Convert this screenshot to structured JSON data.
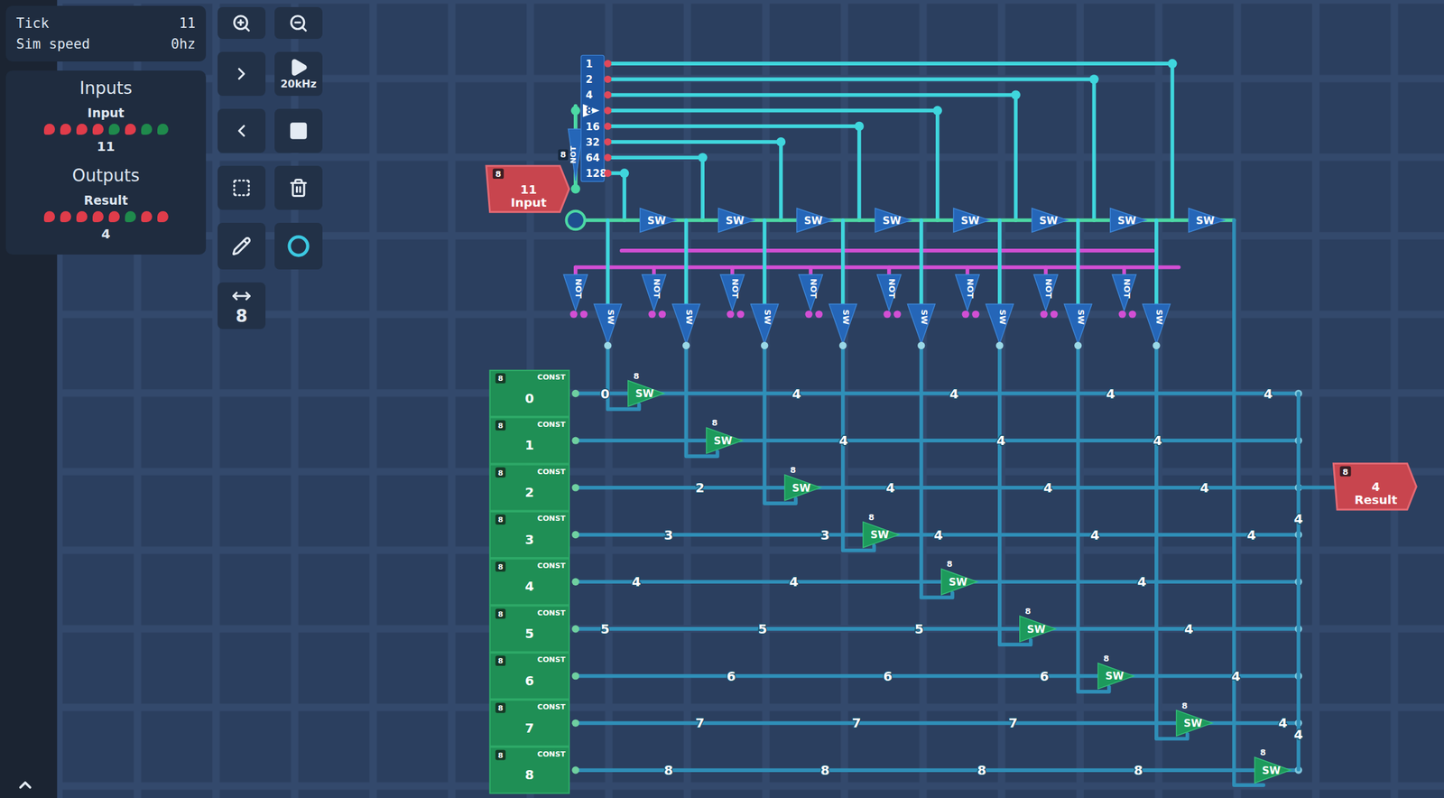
{
  "status": {
    "tick_label": "Tick",
    "tick": "11",
    "speed_label": "Sim speed",
    "speed": "0hz"
  },
  "inputs_panel": {
    "title": "Inputs",
    "items": [
      {
        "name": "Input",
        "bits": [
          false,
          false,
          false,
          false,
          true,
          false,
          true,
          true
        ],
        "value": "11"
      }
    ]
  },
  "outputs_panel": {
    "title": "Outputs",
    "items": [
      {
        "name": "Result",
        "bits": [
          false,
          false,
          false,
          false,
          false,
          true,
          false,
          false
        ],
        "value": "4"
      }
    ]
  },
  "toolbar": [
    {
      "kind": "zoom-in",
      "selected": false
    },
    {
      "kind": "zoom-out",
      "selected": false
    },
    {
      "kind": "step-forward",
      "selected": false
    },
    {
      "kind": "play",
      "label": "20kHz",
      "selected": false
    },
    {
      "kind": "step-back",
      "selected": false
    },
    {
      "kind": "stop",
      "selected": false
    },
    {
      "kind": "select",
      "selected": false
    },
    {
      "kind": "delete",
      "selected": false
    },
    {
      "kind": "pencil",
      "selected": false
    },
    {
      "kind": "wire",
      "selected": true
    },
    {
      "kind": "bit-width",
      "label": "8",
      "selected": false
    }
  ],
  "circuit": {
    "input_node": {
      "label": "Input",
      "value": "11",
      "width": "8"
    },
    "output_node": {
      "label": "Result",
      "value": "4",
      "width": "8"
    },
    "input_not": {
      "label": "NOT",
      "width": "8"
    },
    "splitter": [
      {
        "label": "1",
        "selected": false
      },
      {
        "label": "2",
        "selected": false
      },
      {
        "label": "4",
        "selected": false
      },
      {
        "label": "8",
        "selected": true
      },
      {
        "label": "16",
        "selected": false
      },
      {
        "label": "32",
        "selected": false
      },
      {
        "label": "64",
        "selected": false
      },
      {
        "label": "128",
        "selected": false
      }
    ],
    "top_switches": [
      "SW",
      "SW",
      "SW",
      "SW",
      "SW",
      "SW",
      "SW",
      "SW"
    ],
    "not_gates": [
      "NOT",
      "NOT",
      "NOT",
      "NOT",
      "NOT",
      "NOT",
      "NOT",
      "NOT"
    ],
    "bottom_switches": [
      "SW",
      "SW",
      "SW",
      "SW",
      "SW",
      "SW",
      "SW",
      "SW"
    ],
    "constants": [
      {
        "tag": "CONST",
        "width": "8",
        "value": "0",
        "switch": "SW",
        "switch_width": "8",
        "wire_labels": [
          "0",
          "4",
          "4",
          "4",
          "4"
        ]
      },
      {
        "tag": "CONST",
        "width": "8",
        "value": "1",
        "switch": "SW",
        "switch_width": "8",
        "wire_labels": [
          "4",
          "4",
          "4"
        ]
      },
      {
        "tag": "CONST",
        "width": "8",
        "value": "2",
        "switch": "SW",
        "switch_width": "8",
        "wire_labels": [
          "2",
          "4",
          "4",
          "4"
        ]
      },
      {
        "tag": "CONST",
        "width": "8",
        "value": "3",
        "switch": "SW",
        "switch_width": "8",
        "wire_labels": [
          "3",
          "3",
          "4",
          "4",
          "4"
        ]
      },
      {
        "tag": "CONST",
        "width": "8",
        "value": "4",
        "switch": "SW",
        "switch_width": "8",
        "wire_labels": [
          "4",
          "4",
          "4"
        ]
      },
      {
        "tag": "CONST",
        "width": "8",
        "value": "5",
        "switch": "SW",
        "switch_width": "8",
        "wire_labels": [
          "5",
          "5",
          "5",
          "4"
        ]
      },
      {
        "tag": "CONST",
        "width": "8",
        "value": "6",
        "switch": "SW",
        "switch_width": "8",
        "wire_labels": [
          "6",
          "6",
          "6",
          "4"
        ]
      },
      {
        "tag": "CONST",
        "width": "8",
        "value": "7",
        "switch": "SW",
        "switch_width": "8",
        "wire_labels": [
          "7",
          "7",
          "7",
          "4"
        ]
      },
      {
        "tag": "CONST",
        "width": "8",
        "value": "8",
        "switch": "SW",
        "switch_width": "8",
        "wire_labels": [
          "8",
          "8",
          "8",
          "8"
        ]
      }
    ],
    "bus_labels": [
      "4",
      "4"
    ]
  }
}
